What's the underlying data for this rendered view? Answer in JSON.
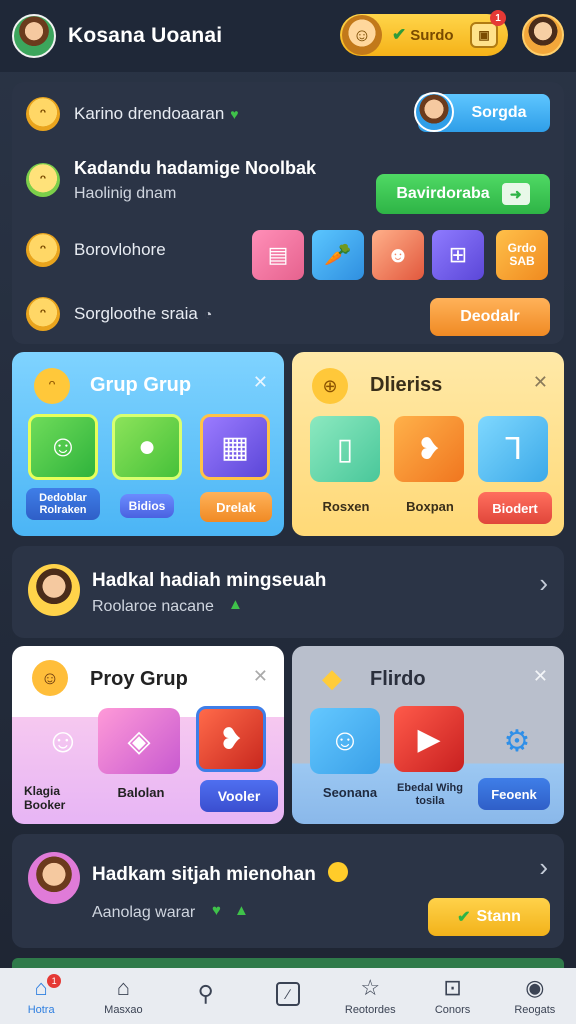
{
  "header": {
    "user_name": "Kosana Uoanai",
    "coin_label": "Surdo",
    "coin_badge": "1"
  },
  "panel": {
    "row1": {
      "text": "Karino drendoaaran",
      "button": "Sorgda"
    },
    "row2": {
      "title": "Kadandu hadamige Noolbak",
      "subtitle": "Haolinig dnam",
      "button": "Bavirdoraba"
    },
    "row3": {
      "text": "Borovlohore",
      "tile_text": "Grdo SAB"
    },
    "row4": {
      "text": "Sorgloothe sraia",
      "button": "Deodalr"
    }
  },
  "card_grup": {
    "title": "Grup Grup",
    "labels": [
      "Dedoblar Rolraken",
      "Bidios",
      "Drelak"
    ]
  },
  "card_diberias": {
    "title": "Dlieriss",
    "labels": [
      "Rosxen",
      "Boxpan",
      "Biodert"
    ]
  },
  "list1": {
    "title": "Hadkal hadiah mingseuah",
    "subtitle": "Roolaroe nacane"
  },
  "card_proy": {
    "title": "Proy Grup",
    "labels": [
      "Klagia Booker",
      "Balolan",
      "Vooler"
    ]
  },
  "card_flirdo": {
    "title": "Flirdo",
    "labels": [
      "Seonana",
      "Ebedal Wihg tosila",
      "Feoenk"
    ]
  },
  "list2": {
    "title": "Hadkam sitjah mienohan",
    "subtitle": "Aanolag warar",
    "button": "Stann"
  },
  "nav": {
    "items": [
      "Hotra",
      "Masxao",
      "",
      "",
      "Reotordes",
      "Conors",
      "Reogats"
    ],
    "badge": "1"
  },
  "colors": {
    "accent_blue": "#2f9ee8",
    "accent_green": "#2eb446",
    "accent_orange": "#f08a24",
    "accent_yellow": "#f2b21a"
  }
}
